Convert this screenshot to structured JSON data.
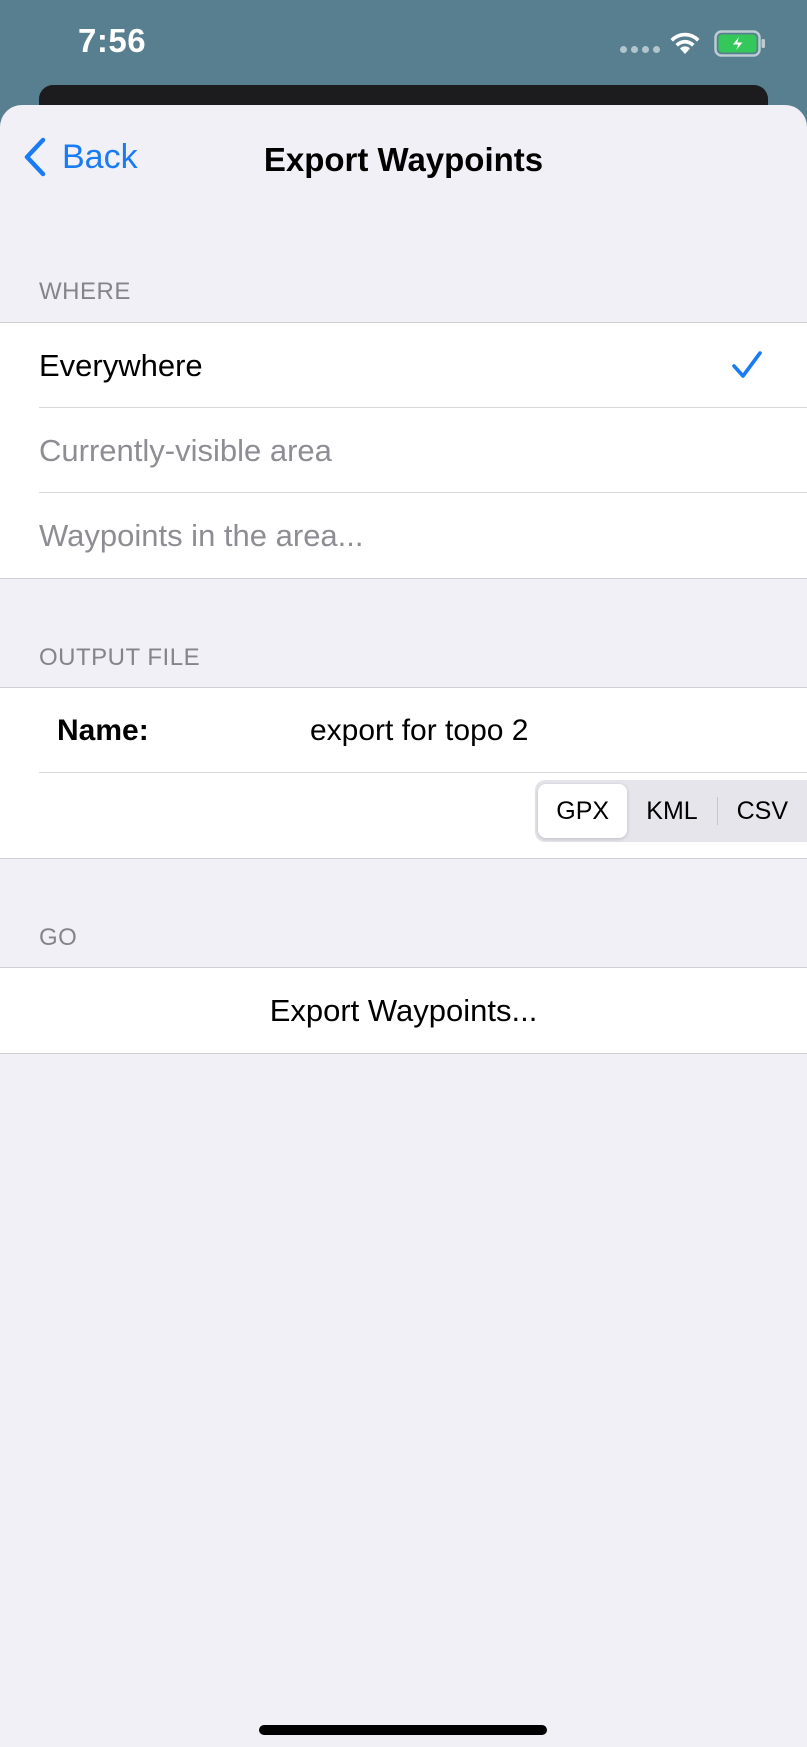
{
  "status_bar": {
    "time": "7:56"
  },
  "nav": {
    "back_label": "Back",
    "title": "Export Waypoints"
  },
  "where": {
    "header": "WHERE",
    "options": [
      {
        "label": "Everywhere",
        "selected": true
      },
      {
        "label": "Currently-visible area",
        "selected": false
      },
      {
        "label": "Waypoints in the area...",
        "selected": false
      }
    ]
  },
  "output_file": {
    "header": "OUTPUT FILE",
    "name_label": "Name:",
    "name_value": "export for topo 2",
    "formats": [
      "GPX",
      "KML",
      "CSV"
    ],
    "selected_format": "GPX"
  },
  "go": {
    "header": "GO",
    "export_label": "Export Waypoints..."
  },
  "colors": {
    "accent": "#1a7cf5",
    "status_bar_bg": "#577f8f",
    "sheet_bg": "#f1f0f6",
    "battery_green": "#34c759"
  }
}
